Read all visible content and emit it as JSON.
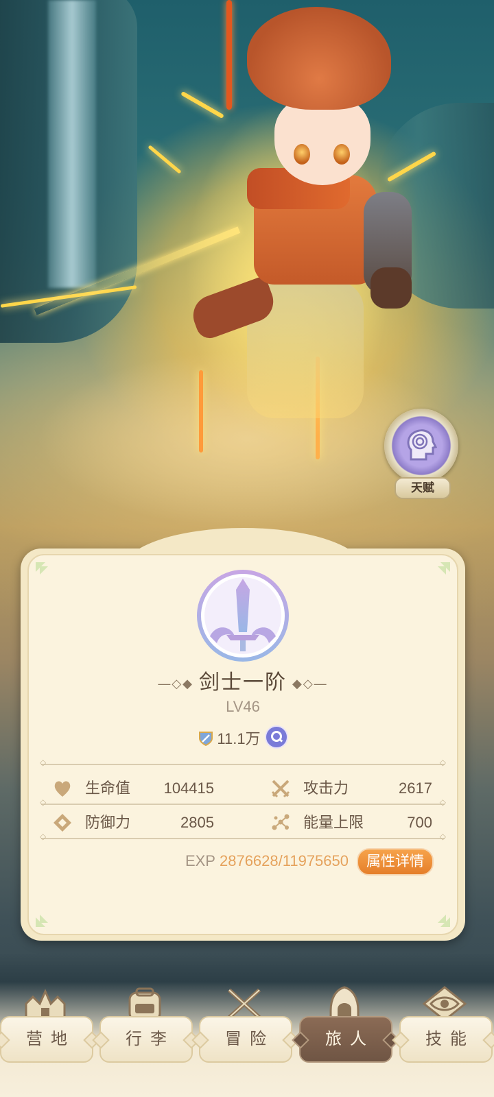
{
  "talent": {
    "label": "天赋"
  },
  "character": {
    "class_name": "剑士一阶",
    "level": "LV46",
    "power": "11.1万"
  },
  "stats": [
    {
      "icon": "heart-icon",
      "label": "生命值",
      "value": "104415"
    },
    {
      "icon": "crossed-swords-icon",
      "label": "攻击力",
      "value": "2617"
    },
    {
      "icon": "diamond-shield-icon",
      "label": "防御力",
      "value": "2805"
    },
    {
      "icon": "energy-nodes-icon",
      "label": "能量上限",
      "value": "700"
    }
  ],
  "exp": {
    "label": "EXP",
    "value": "2876628/11975650"
  },
  "detail_button": "属性详情",
  "nav": [
    {
      "icon": "camp-icon",
      "label": "营地",
      "active": false
    },
    {
      "icon": "backpack-icon",
      "label": "行李",
      "active": false
    },
    {
      "icon": "swords-icon",
      "label": "冒险",
      "active": false
    },
    {
      "icon": "hooded-traveler-icon",
      "label": "旅人",
      "active": true
    },
    {
      "icon": "eye-emblem-icon",
      "label": "技能",
      "active": false
    }
  ],
  "colors": {
    "card_bg": "#fbf3de",
    "accent_orange": "#e57f2a",
    "exp_value": "#e5a25c",
    "text_brown": "#6b5848",
    "nav_active": "#6f5544"
  }
}
